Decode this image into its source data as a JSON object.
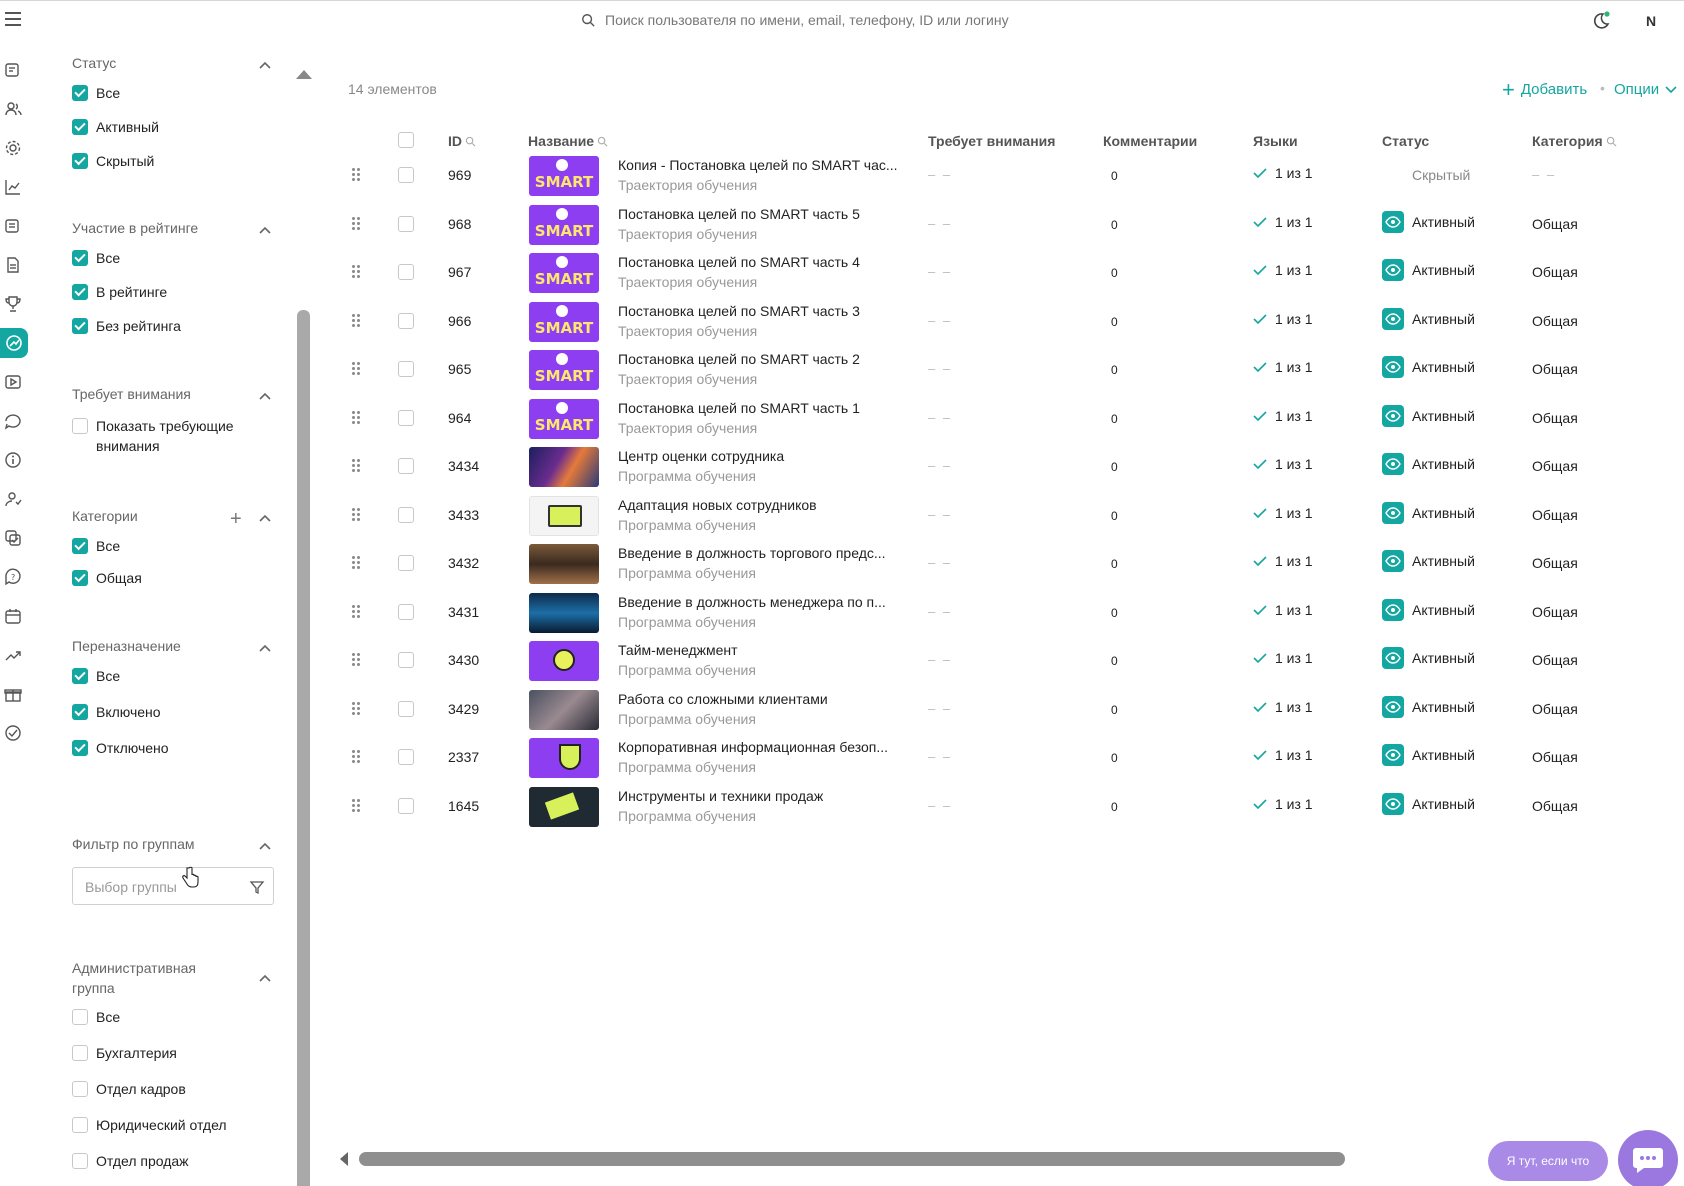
{
  "search": {
    "placeholder": "Поиск пользователя по имени, email, телефону, ID или логину"
  },
  "user": {
    "initial": "N"
  },
  "filters": {
    "status": {
      "title": "Статус",
      "options": [
        "Все",
        "Активный",
        "Скрытый"
      ]
    },
    "rating": {
      "title": "Участие в рейтинге",
      "options": [
        "Все",
        "В рейтинге",
        "Без рейтинга"
      ]
    },
    "attention": {
      "title": "Требует внимания",
      "option_line1": "Показать требующие",
      "option_line2": "внимания"
    },
    "categories": {
      "title": "Категории",
      "plus": "+",
      "options": [
        "Все",
        "Общая"
      ]
    },
    "reassign": {
      "title": "Переназначение",
      "options": [
        "Все",
        "Включено",
        "Отключено"
      ]
    },
    "groups": {
      "title": "Фильтр по группам",
      "select_placeholder": "Выбор группы"
    },
    "admin_group": {
      "title_line1": "Административная",
      "title_line2": "группа",
      "options": [
        "Все",
        "Бухгалтерия",
        "Отдел кадров",
        "Юридический отдел",
        "Отдел продаж"
      ]
    }
  },
  "main": {
    "count": "14 элементов",
    "add_label": "Добавить",
    "dot": "•",
    "options_label": "Опции",
    "columns": {
      "id": "ID",
      "name": "Название",
      "attention": "Требует внимания",
      "comments": "Комментарии",
      "languages": "Языки",
      "status": "Статус",
      "category": "Категория"
    },
    "rows": [
      {
        "id": "969",
        "name": "Копия - Постановка целей по SMART час...",
        "type": "Траектория обучения",
        "attention": "– –",
        "comments": "0",
        "lang": "1 из 1",
        "status": "Скрытый",
        "category": "– –",
        "thumb": "smart"
      },
      {
        "id": "968",
        "name": "Постановка целей по SMART часть 5",
        "type": "Траектория обучения",
        "attention": "– –",
        "comments": "0",
        "lang": "1 из 1",
        "status": "Активный",
        "category": "Общая",
        "thumb": "smart"
      },
      {
        "id": "967",
        "name": "Постановка целей по SMART часть 4",
        "type": "Траектория обучения",
        "attention": "– –",
        "comments": "0",
        "lang": "1 из 1",
        "status": "Активный",
        "category": "Общая",
        "thumb": "smart"
      },
      {
        "id": "966",
        "name": "Постановка целей по SMART часть 3",
        "type": "Траектория обучения",
        "attention": "– –",
        "comments": "0",
        "lang": "1 из 1",
        "status": "Активный",
        "category": "Общая",
        "thumb": "smart"
      },
      {
        "id": "965",
        "name": "Постановка целей по SMART часть 2",
        "type": "Траектория обучения",
        "attention": "– –",
        "comments": "0",
        "lang": "1 из 1",
        "status": "Активный",
        "category": "Общая",
        "thumb": "smart"
      },
      {
        "id": "964",
        "name": "Постановка целей по SMART часть 1",
        "type": "Траектория обучения",
        "attention": "– –",
        "comments": "0",
        "lang": "1 из 1",
        "status": "Активный",
        "category": "Общая",
        "thumb": "smart"
      },
      {
        "id": "3434",
        "name": "Центр оценки сотрудника",
        "type": "Программа обучения",
        "attention": "– –",
        "comments": "0",
        "lang": "1 из 1",
        "status": "Активный",
        "category": "Общая",
        "thumb": "space"
      },
      {
        "id": "3433",
        "name": "Адаптация новых сотрудников",
        "type": "Программа обучения",
        "attention": "– –",
        "comments": "0",
        "lang": "1 из 1",
        "status": "Активный",
        "category": "Общая",
        "thumb": "monitor"
      },
      {
        "id": "3432",
        "name": "Введение в должность торгового предс...",
        "type": "Программа обучения",
        "attention": "– –",
        "comments": "0",
        "lang": "1 из 1",
        "status": "Активный",
        "category": "Общая",
        "thumb": "city"
      },
      {
        "id": "3431",
        "name": "Введение в должность менеджера по п...",
        "type": "Программа обучения",
        "attention": "– –",
        "comments": "0",
        "lang": "1 из 1",
        "status": "Активный",
        "category": "Общая",
        "thumb": "tech"
      },
      {
        "id": "3430",
        "name": "Тайм-менеджмент",
        "type": "Программа обучения",
        "attention": "– –",
        "comments": "0",
        "lang": "1 из 1",
        "status": "Активный",
        "category": "Общая",
        "thumb": "time"
      },
      {
        "id": "3429",
        "name": "Работа со сложными клиентами",
        "type": "Программа обучения",
        "attention": "– –",
        "comments": "0",
        "lang": "1 из 1",
        "status": "Активный",
        "category": "Общая",
        "thumb": "people"
      },
      {
        "id": "2337",
        "name": "Корпоративная информационная безоп...",
        "type": "Программа обучения",
        "attention": "– –",
        "comments": "0",
        "lang": "1 из 1",
        "status": "Активный",
        "category": "Общая",
        "thumb": "security"
      },
      {
        "id": "1645",
        "name": "Инструменты и техники продаж",
        "type": "Программа обучения",
        "attention": "– –",
        "comments": "0",
        "lang": "1 из 1",
        "status": "Активный",
        "category": "Общая",
        "thumb": "sales"
      }
    ]
  },
  "chat": {
    "bubble_text": "Я тут, если что"
  },
  "colors": {
    "accent": "#14a6a0",
    "chat": "#9a78e0",
    "smart": "#8c3ef0"
  },
  "icons": [
    "menu-icon",
    "search-icon",
    "theme-icon",
    "drag-handle-icon",
    "eye-icon",
    "check-icon",
    "filter-icon",
    "chat-icon"
  ]
}
